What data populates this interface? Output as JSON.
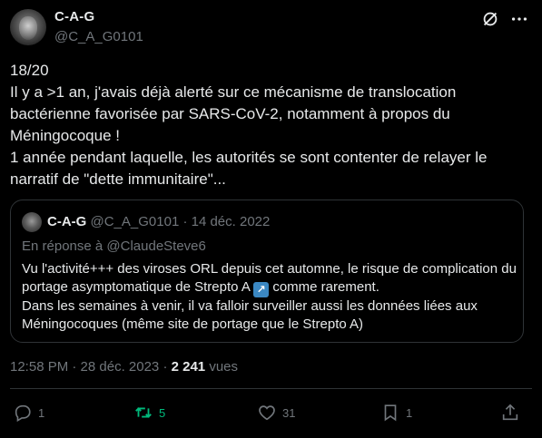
{
  "author": {
    "display_name": "C-A-G",
    "handle": "@C_A_G0101"
  },
  "tweet": {
    "lines": [
      "18/20",
      "Il y a >1 an, j'avais déjà alerté sur ce mécanisme de translocation bactérienne favorisée par SARS-CoV-2, notamment à propos du Méningocoque !",
      "1 année pendant laquelle, les autorités se sont contenter de relayer le narratif de \"dette immunitaire\"..."
    ]
  },
  "quote": {
    "display_name": "C-A-G",
    "meta": "@C_A_G0101 · 14 déc. 2022",
    "reply_to": "En réponse à @ClaudeSteve6",
    "text_part1": "Vu l'activité+++ des viroses ORL depuis cet automne, le risque de complication du portage asymptomatique de Strepto A",
    "arrow": "↗",
    "text_part2": " comme rarement.",
    "text_line2": "Dans les semaines à venir, il va falloir surveiller aussi les données liées aux Méningocoques (même site de portage que le Strepto A)"
  },
  "meta": {
    "time": "12:58 PM · 28 déc. 2023 · ",
    "views_count": "2 241",
    "views_label": " vues"
  },
  "actions": {
    "replies": "1",
    "retweets": "5",
    "likes": "31",
    "bookmarks": "1"
  },
  "colors": {
    "background": "#000000",
    "text": "#e7e9ea",
    "muted": "#71767b",
    "border": "#2f3336",
    "retweet_green": "#00ba7c"
  },
  "icons": [
    "grok-icon",
    "more-icon",
    "reply-icon",
    "retweet-icon",
    "like-icon",
    "bookmark-icon",
    "share-icon"
  ]
}
